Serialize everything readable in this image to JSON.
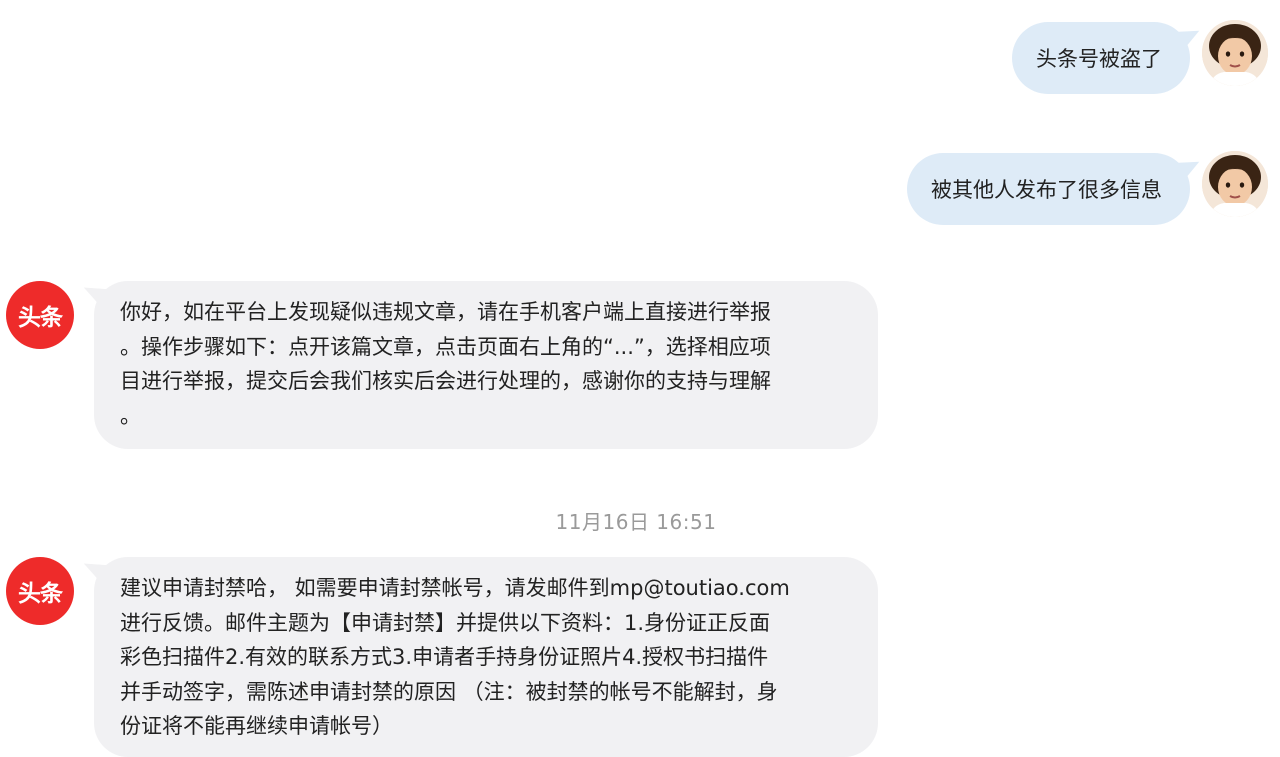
{
  "messages": [
    {
      "sender": "user",
      "text": "头条号被盗了"
    },
    {
      "sender": "user",
      "text": "被其他人发布了很多信息"
    },
    {
      "sender": "system",
      "avatar_label": "头条",
      "lines": [
        "你好，如在平台上发现疑似违规文章，请在手机客户端上直接进行举报",
        "。操作步骤如下：点开该篇文章，点击页面右上角的“...”，选择相应项",
        "目进行举报，提交后会我们核实后会进行处理的，感谢你的支持与理解",
        "。"
      ]
    },
    {
      "sender": "timestamp",
      "text": "11月16日 16:51"
    },
    {
      "sender": "system",
      "avatar_label": "头条",
      "lines": [
        "建议申请封禁哈， 如需要申请封禁帐号，请发邮件到mp@toutiao.com",
        "进行反馈。邮件主题为【申请封禁】并提供以下资料：1.身份证正反面",
        "彩色扫描件2.有效的联系方式3.申请者手持身份证照片4.授权书扫描件",
        "并手动签字，需陈述申请封禁的原因 （注：被封禁的帐号不能解封，身",
        "份证将不能再继续申请帐号）"
      ]
    }
  ],
  "colors": {
    "user_bubble": "#deebf7",
    "system_bubble": "#f1f1f3",
    "brand_red": "#ee2b2a",
    "timestamp_text": "#9a9a9a"
  },
  "icons": {
    "user_avatar": "child-portrait-avatar",
    "system_avatar": "toutiao-logo-avatar"
  }
}
